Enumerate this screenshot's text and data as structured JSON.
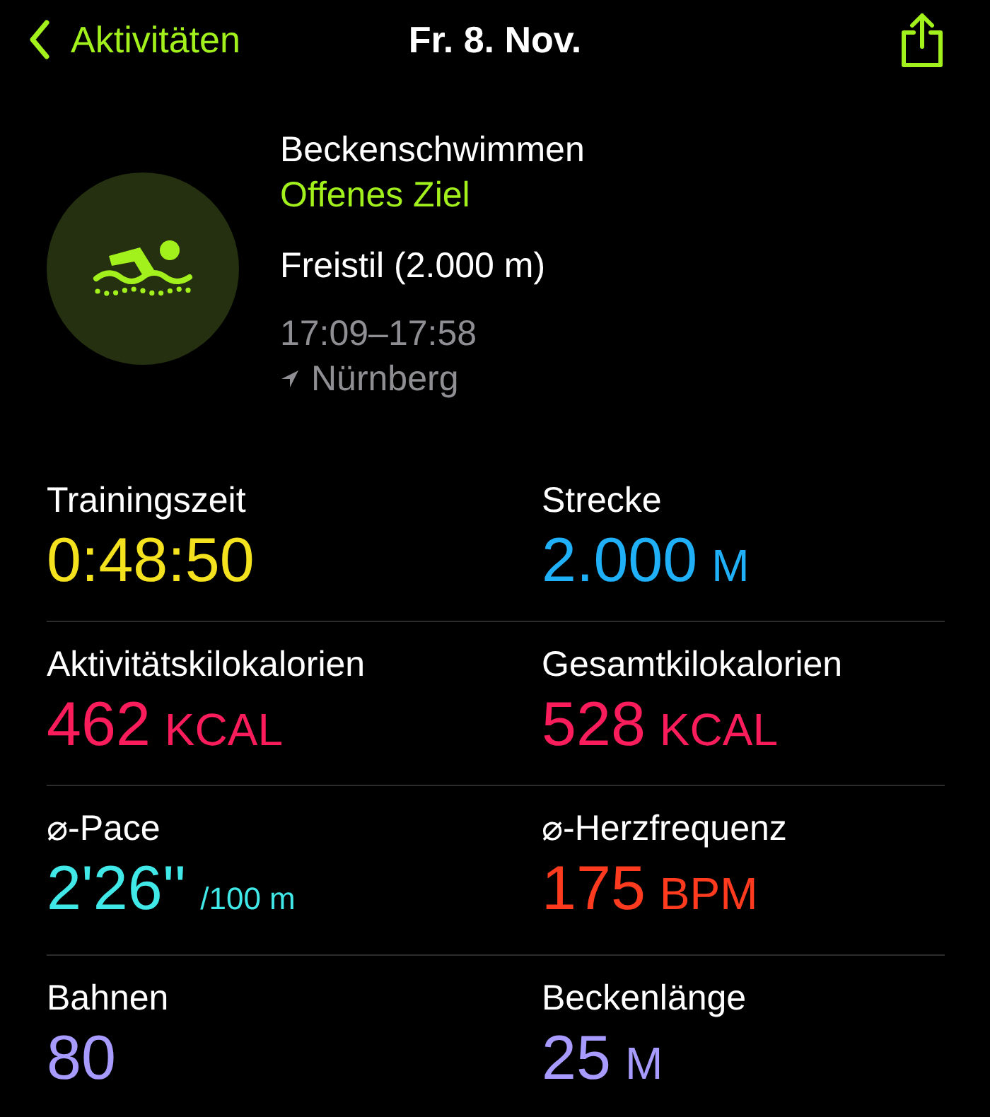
{
  "nav": {
    "back_label": "Aktivitäten",
    "title": "Fr. 8. Nov."
  },
  "workout": {
    "name": "Beckenschwimmen",
    "goal": "Offenes Ziel",
    "detail": "Freistil (2.000 m)",
    "time": "17:09–17:58",
    "location": "Nürnberg"
  },
  "metrics": [
    {
      "label": "Trainingszeit",
      "value": "0:48:50",
      "color": "#f5e21e"
    },
    {
      "label": "Strecke",
      "value": "2.000",
      "unit": "M",
      "kind": "caps",
      "color": "#1fb0f7"
    },
    {
      "label": "Aktivitätskilokalorien",
      "value": "462",
      "unit": "KCAL",
      "kind": "caps",
      "color": "#fb1d5b"
    },
    {
      "label": "Gesamtkilokalorien",
      "value": "528",
      "unit": "KCAL",
      "kind": "caps",
      "color": "#fb1d5b"
    },
    {
      "label": "⌀-Pace",
      "value": "2'26''",
      "unit": "/100 m",
      "kind": "small",
      "color": "#40e8e8"
    },
    {
      "label": "⌀-Herzfrequenz",
      "value": "175",
      "unit": "BPM",
      "kind": "caps",
      "color": "#ff3b1f"
    },
    {
      "label": "Bahnen",
      "value": "80",
      "color": "#a79bff"
    },
    {
      "label": "Beckenlänge",
      "value": "25",
      "unit": "M",
      "kind": "caps",
      "color": "#a79bff"
    }
  ]
}
